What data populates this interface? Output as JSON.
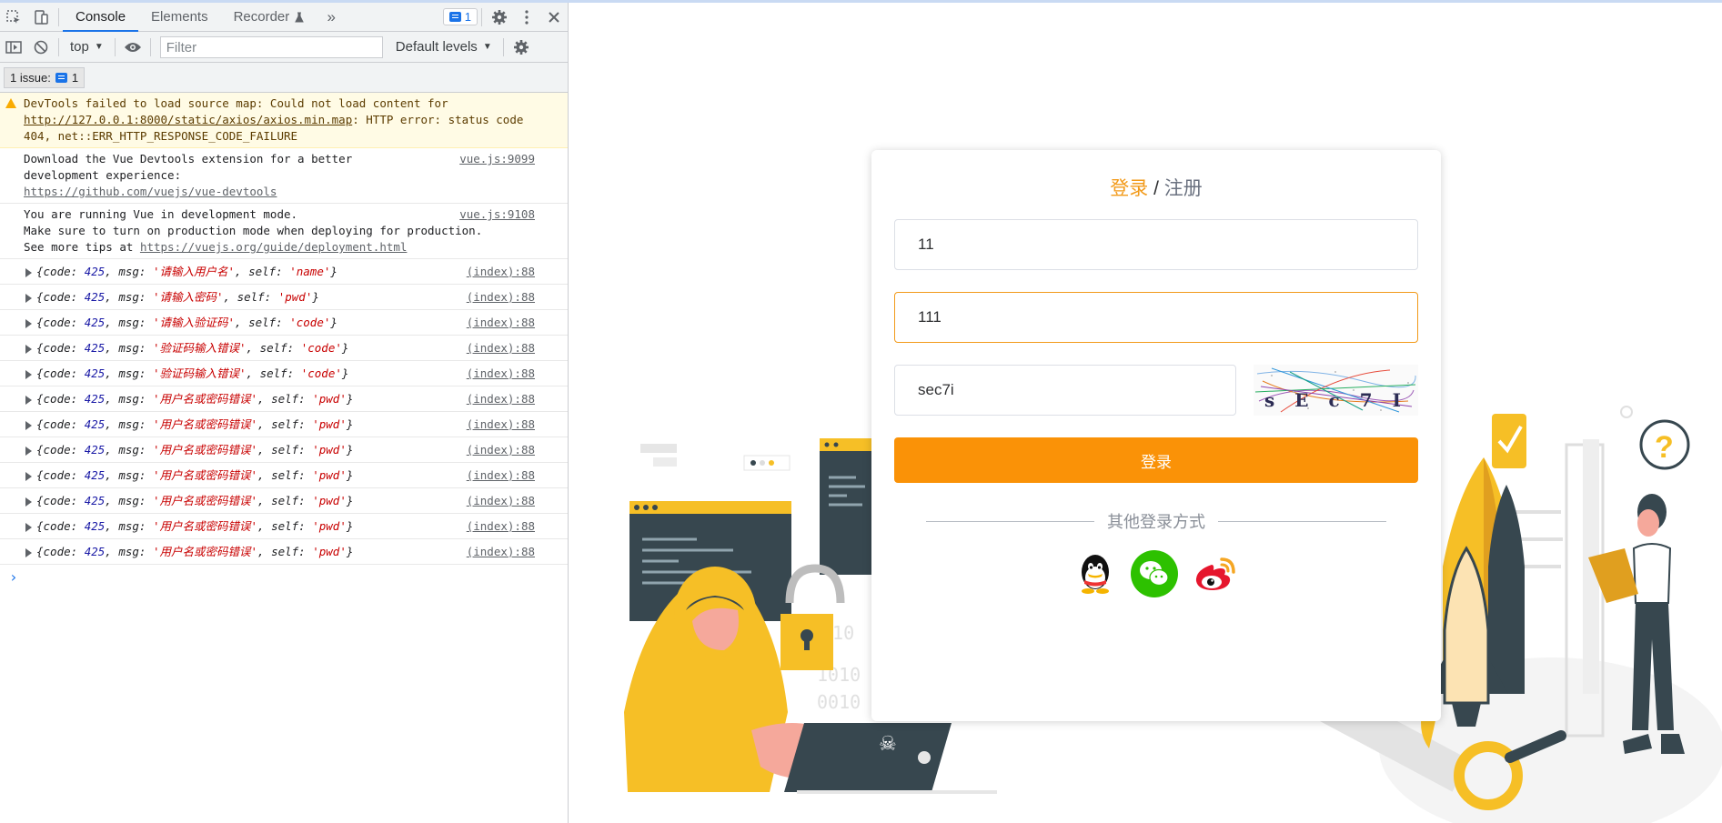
{
  "devtools": {
    "tabs": [
      "Console",
      "Elements",
      "Recorder"
    ],
    "message_count": "1",
    "context": "top",
    "filter_placeholder": "Filter",
    "levels": "Default levels",
    "issues_label": "1 issue:",
    "issues_count": "1"
  },
  "console": {
    "warning": {
      "text_prefix": "DevTools failed to load source map: Could not load content for ",
      "url": "http://127.0.0.1:8000/static/axios/axios.min.map",
      "text_suffix": ": HTTP error: status code 404, net::ERR_HTTP_RESPONSE_CODE_FAILURE"
    },
    "vue_devtools": {
      "text": "Download the Vue Devtools extension for a better development experience:",
      "url": "https://github.com/vuejs/vue-devtools",
      "source": "vue.js:9099"
    },
    "vue_dev_mode": {
      "line1": "You are running Vue in development mode.",
      "line2": "Make sure to turn on production mode when deploying for production.",
      "line3_prefix": "See more tips at ",
      "url": "https://vuejs.org/guide/deployment.html",
      "source": "vue.js:9108"
    },
    "objects": [
      {
        "code": "425",
        "msg": "'请输入用户名'",
        "self": "'name'",
        "source": "(index):88"
      },
      {
        "code": "425",
        "msg": "'请输入密码'",
        "self": "'pwd'",
        "source": "(index):88"
      },
      {
        "code": "425",
        "msg": "'请输入验证码'",
        "self": "'code'",
        "source": "(index):88"
      },
      {
        "code": "425",
        "msg": "'验证码输入错误'",
        "self": "'code'",
        "source": "(index):88"
      },
      {
        "code": "425",
        "msg": "'验证码输入错误'",
        "self": "'code'",
        "source": "(index):88"
      },
      {
        "code": "425",
        "msg": "'用户名或密码错误'",
        "self": "'pwd'",
        "source": "(index):88"
      },
      {
        "code": "425",
        "msg": "'用户名或密码错误'",
        "self": "'pwd'",
        "source": "(index):88"
      },
      {
        "code": "425",
        "msg": "'用户名或密码错误'",
        "self": "'pwd'",
        "source": "(index):88"
      },
      {
        "code": "425",
        "msg": "'用户名或密码错误'",
        "self": "'pwd'",
        "source": "(index):88"
      },
      {
        "code": "425",
        "msg": "'用户名或密码错误'",
        "self": "'pwd'",
        "source": "(index):88"
      },
      {
        "code": "425",
        "msg": "'用户名或密码错误'",
        "self": "'pwd'",
        "source": "(index):88"
      },
      {
        "code": "425",
        "msg": "'用户名或密码错误'",
        "self": "'pwd'",
        "source": "(index):88"
      }
    ],
    "prompt": "›"
  },
  "login": {
    "title_login": "登录",
    "title_sep": " / ",
    "title_register": "注册",
    "username_value": "11",
    "password_value": "111",
    "code_value": "sec7i",
    "captcha_text": "sEc7I",
    "submit_label": "登录",
    "other_login_label": "其他登录方式",
    "social_icons": [
      "qq-icon",
      "wechat-icon",
      "weibo-icon"
    ],
    "accent_color": "#fa9207"
  }
}
